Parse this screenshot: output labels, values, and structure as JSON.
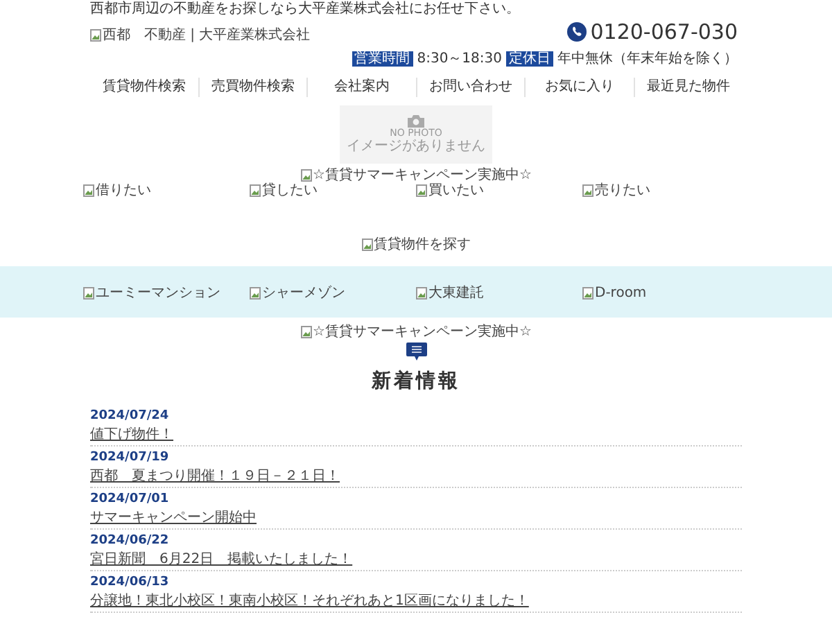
{
  "header": {
    "tagline": "西都市周辺の不動産をお探しなら大平産業株式会社にお任せ下さい。",
    "logo_alt": "西都　不動産 | 大平産業株式会社",
    "phone": "0120-067-030",
    "info": [
      {
        "label": "営業時間",
        "value": "8:30～18:30"
      },
      {
        "label": "定休日",
        "value": "年中無休（年末年始を除く）"
      }
    ]
  },
  "nav": [
    "賃貸物件検索",
    "売買物件検索",
    "会社案内",
    "お問い合わせ",
    "お気に入り",
    "最近見た物件"
  ],
  "no_photo": {
    "title": "NO PHOTO",
    "subtitle": "イメージがありません"
  },
  "campaign_banner": "☆賃貸サマーキャンペーン実施中☆",
  "purpose_links": [
    "借りたい",
    "貸したい",
    "買いたい",
    "売りたい"
  ],
  "search_banner": "賃貸物件を探す",
  "brand_links": [
    "ユーミーマンション",
    "シャーメゾン",
    "大東建託",
    "D-room"
  ],
  "campaign_banner_2": "☆賃貸サマーキャンペーン実施中☆",
  "news": {
    "title": "新着情報",
    "items": [
      {
        "date": "2024/07/24",
        "title": "値下げ物件！"
      },
      {
        "date": "2024/07/19",
        "title": "西都　夏まつり開催！１９日－２１日！"
      },
      {
        "date": "2024/07/01",
        "title": "サマーキャンペーン開始中"
      },
      {
        "date": "2024/06/22",
        "title": "宮日新聞　6月22日　掲載いたしました！"
      },
      {
        "date": "2024/06/13",
        "title": "分譲地！東北小校区！東南小校区！それぞれあと1区画になりました！"
      }
    ]
  }
}
